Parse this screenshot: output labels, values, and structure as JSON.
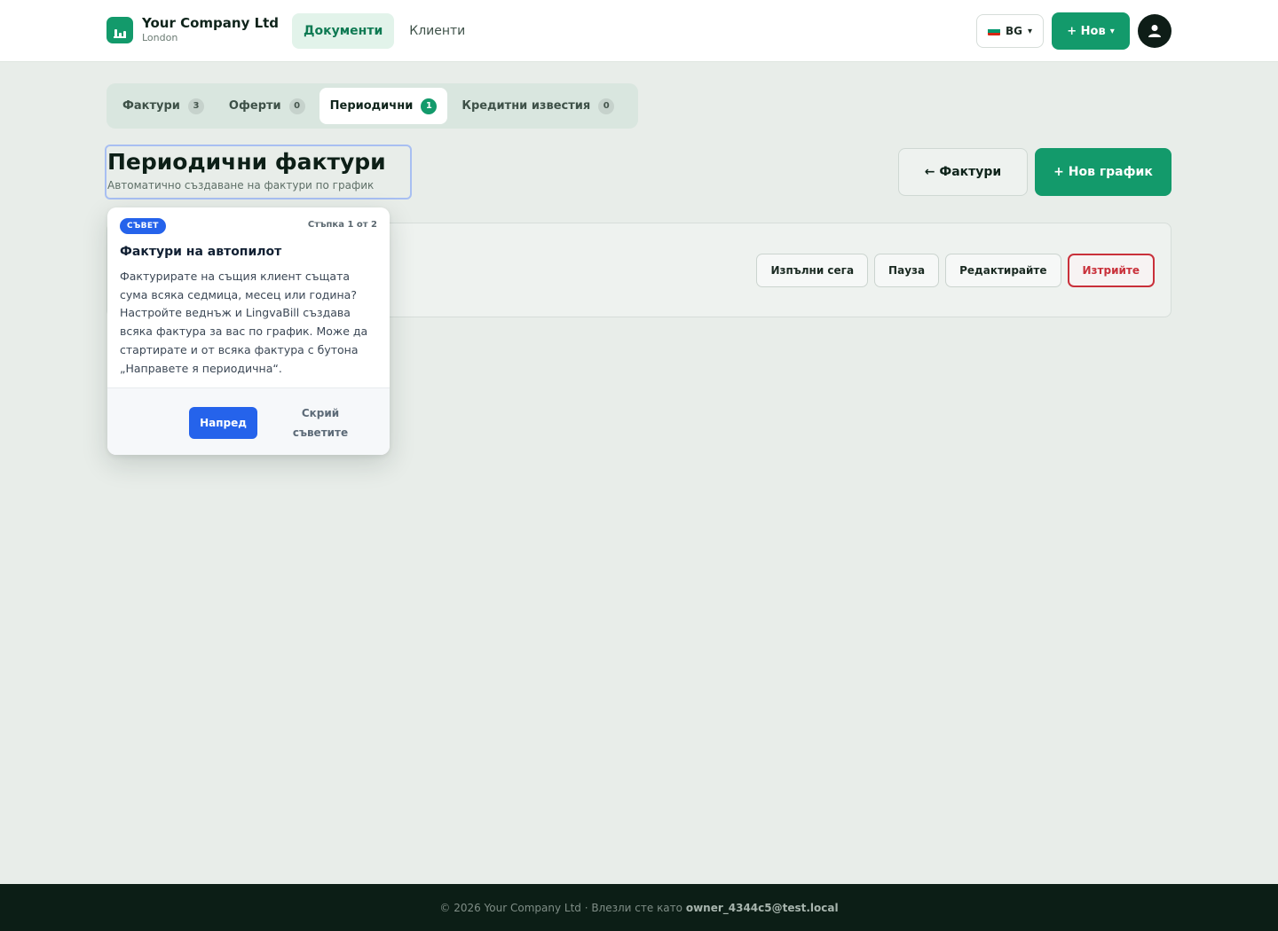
{
  "header": {
    "company_name": "Your Company Ltd",
    "company_city": "London",
    "nav": [
      {
        "label": "Документи",
        "active": true
      },
      {
        "label": "Клиенти",
        "active": false
      }
    ],
    "language": "BG",
    "language_caret": "▾",
    "new_button": "+ Нов",
    "new_caret": "▾",
    "icons": {
      "logo": "chart-logo-icon",
      "flag": "bulgaria-flag-icon",
      "avatar": "user-avatar-icon"
    }
  },
  "tabs": [
    {
      "label": "Фактури",
      "count": "3",
      "active": false
    },
    {
      "label": "Оферти",
      "count": "0",
      "active": false
    },
    {
      "label": "Периодични",
      "count": "1",
      "active": true
    },
    {
      "label": "Кредитни известия",
      "count": "0",
      "active": false
    }
  ],
  "page": {
    "title": "Периодични фактури",
    "subtitle": "Автоматично създаване на фактури по график",
    "back_button": "← Фактури",
    "new_schedule_button": "+ Нов график"
  },
  "card": {
    "actions": {
      "run_now": "Изпълни сега",
      "pause": "Пауза",
      "edit": "Редактирайте",
      "delete": "Изтрийте"
    }
  },
  "tip": {
    "badge": "СЪВЕТ",
    "step": "Стъпка 1 от 2",
    "title": "Фактури на автопилот",
    "body": "Фактурирате на същия клиент същата сума всяка седмица, месец или година? Настройте веднъж и LingvaBill създава всяка фактура за вас по график. Може да стартирате и от всяка фактура с бутона „Направете я периодична“.",
    "next_button": "Напред",
    "hide_button": "Скрий съветите"
  },
  "footer": {
    "prefix": "© 2026 Your Company Ltd · Влезли сте като",
    "user_email": "owner_4344c5@test.local"
  },
  "colors": {
    "brand_green": "#139a6b",
    "tip_blue": "#2563eb",
    "danger_red": "#c9303a",
    "footer_bg": "#0c1e16"
  }
}
